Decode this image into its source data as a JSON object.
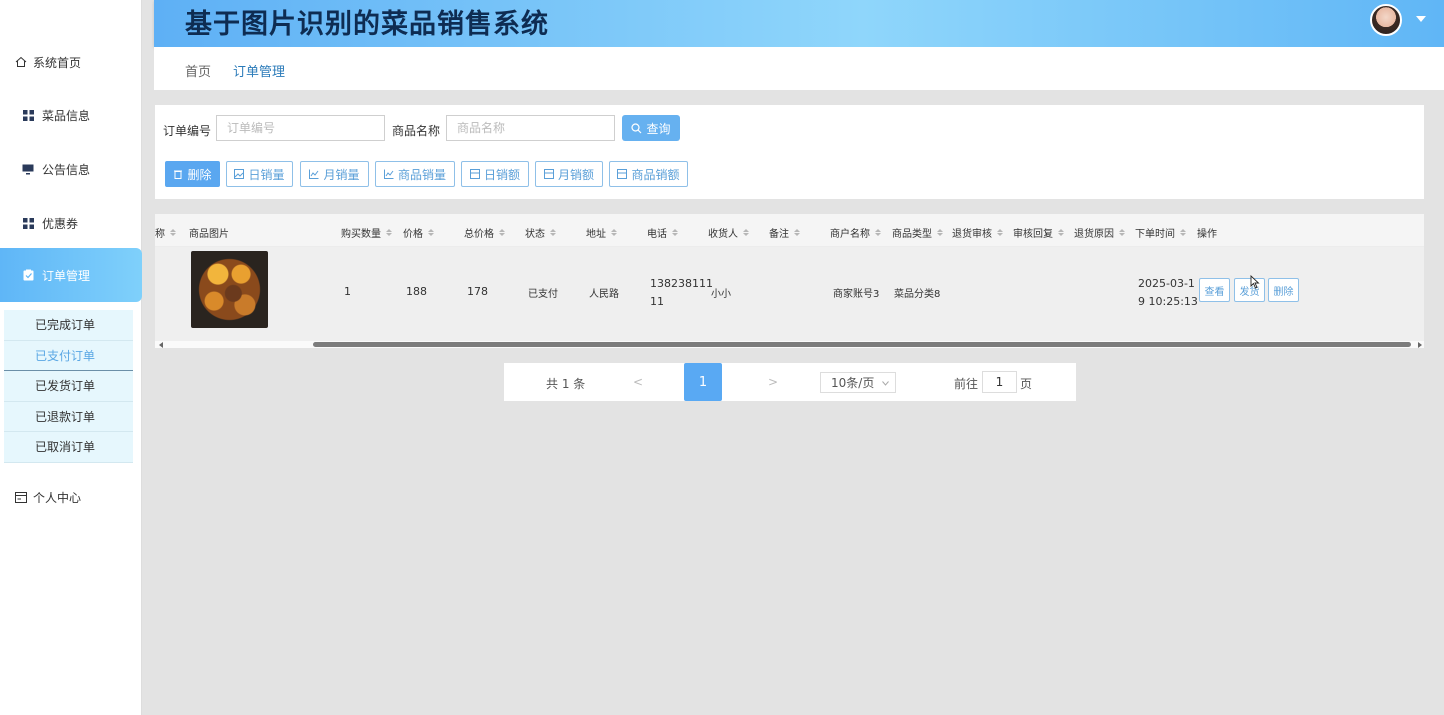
{
  "header": {
    "title": "基于图片识别的菜品销售系统"
  },
  "sidebar": {
    "items": [
      {
        "label": "系统首页",
        "icon": "home-icon"
      },
      {
        "label": "菜品信息",
        "icon": "grid-icon"
      },
      {
        "label": "公告信息",
        "icon": "monitor-icon"
      },
      {
        "label": "优惠券",
        "icon": "grid-icon"
      },
      {
        "label": "订单管理",
        "icon": "clipboard-icon"
      },
      {
        "label": "个人中心",
        "icon": "card-icon"
      }
    ],
    "sub_items": [
      "已完成订单",
      "已支付订单",
      "已发货订单",
      "已退款订单",
      "已取消订单"
    ]
  },
  "breadcrumb": {
    "home": "首页",
    "current": "订单管理"
  },
  "filters": {
    "order_no_label": "订单编号",
    "order_no_placeholder": "订单编号",
    "product_name_label": "商品名称",
    "product_name_placeholder": "商品名称",
    "query_label": "查询"
  },
  "toolbar": {
    "delete": "删除",
    "daily_sales_qty": "日销量",
    "monthly_sales_qty": "月销量",
    "product_sales_qty": "商品销量",
    "daily_sales_amt": "日销额",
    "monthly_sales_amt": "月销额",
    "product_sales_amt": "商品销额"
  },
  "table": {
    "headers": [
      "称",
      "商品图片",
      "购买数量",
      "价格",
      "总价格",
      "状态",
      "地址",
      "电话",
      "收货人",
      "备注",
      "商户名称",
      "商品类型",
      "退货审核",
      "审核回复",
      "退货原因",
      "下单时间",
      "操作"
    ],
    "row": {
      "quantity": "1",
      "price": "188",
      "total": "178",
      "status": "已支付",
      "address": "人民路",
      "phone_l1": "138238111",
      "phone_l2": "11",
      "receiver": "小小",
      "merchant": "商家账号3",
      "category": "菜品分类8",
      "time_l1": "2025-03-1",
      "time_l2": "9 10:25:13",
      "op_view": "查看",
      "op_ship": "发货",
      "op_delete": "删除"
    }
  },
  "pagination": {
    "total": "共 1 条",
    "prev": "<",
    "current": "1",
    "next": ">",
    "page_size": "10条/页",
    "goto_label": "前往",
    "goto_value": "1",
    "page_unit": "页"
  },
  "colors": {
    "accent": "#5aa7f0",
    "header_from": "#5eb0f5",
    "header_to": "#8fd6fb"
  }
}
